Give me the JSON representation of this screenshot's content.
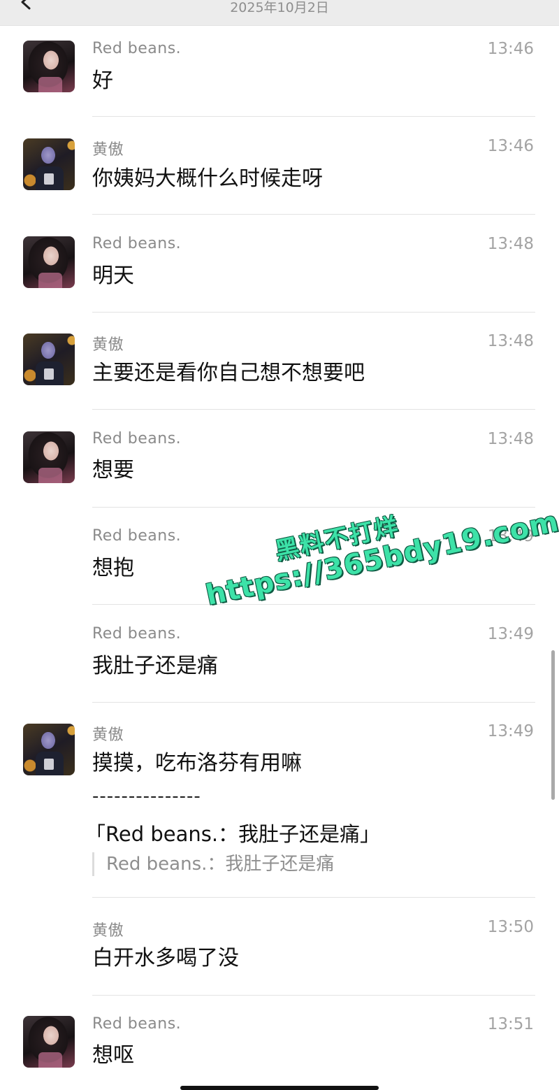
{
  "header": {
    "date": "2025年10月2日",
    "back_icon": "chevron-left-icon"
  },
  "messages": [
    {
      "sender": "Red  beans.",
      "time": "13:46",
      "text": "好",
      "avatar": "red-beans"
    },
    {
      "sender": "黄傲",
      "time": "13:46",
      "text": "你姨妈大概什么时候走呀",
      "avatar": "huang-ao"
    },
    {
      "sender": "Red  beans.",
      "time": "13:48",
      "text": "明天",
      "avatar": "red-beans"
    },
    {
      "sender": "黄傲",
      "time": "13:48",
      "text": "主要还是看你自己想不想要吧",
      "avatar": "huang-ao"
    },
    {
      "sender": "Red  beans.",
      "time": "13:48",
      "text": "想要",
      "avatar": "red-beans"
    },
    {
      "sender": "Red  beans.",
      "time": "13:49",
      "text": "想抱",
      "avatar": ""
    },
    {
      "sender": "Red  beans.",
      "time": "13:49",
      "text": "我肚子还是痛",
      "avatar": ""
    },
    {
      "sender": "黄傲",
      "time": "13:49",
      "text": "摸摸，吃布洛芬有用嘛",
      "avatar": "huang-ao",
      "divider": "---------------",
      "quote_title": "「Red  beans.：我肚子还是痛」",
      "quote_text": "Red  beans.：我肚子还是痛"
    },
    {
      "sender": "黄傲",
      "time": "13:50",
      "text": "白开水多喝了没",
      "avatar": ""
    },
    {
      "sender": "Red  beans.",
      "time": "13:51",
      "text": "想呕",
      "avatar": "red-beans"
    }
  ],
  "watermark": {
    "line1": "黑料不打烊",
    "line2": "https://365bdy19.com"
  }
}
